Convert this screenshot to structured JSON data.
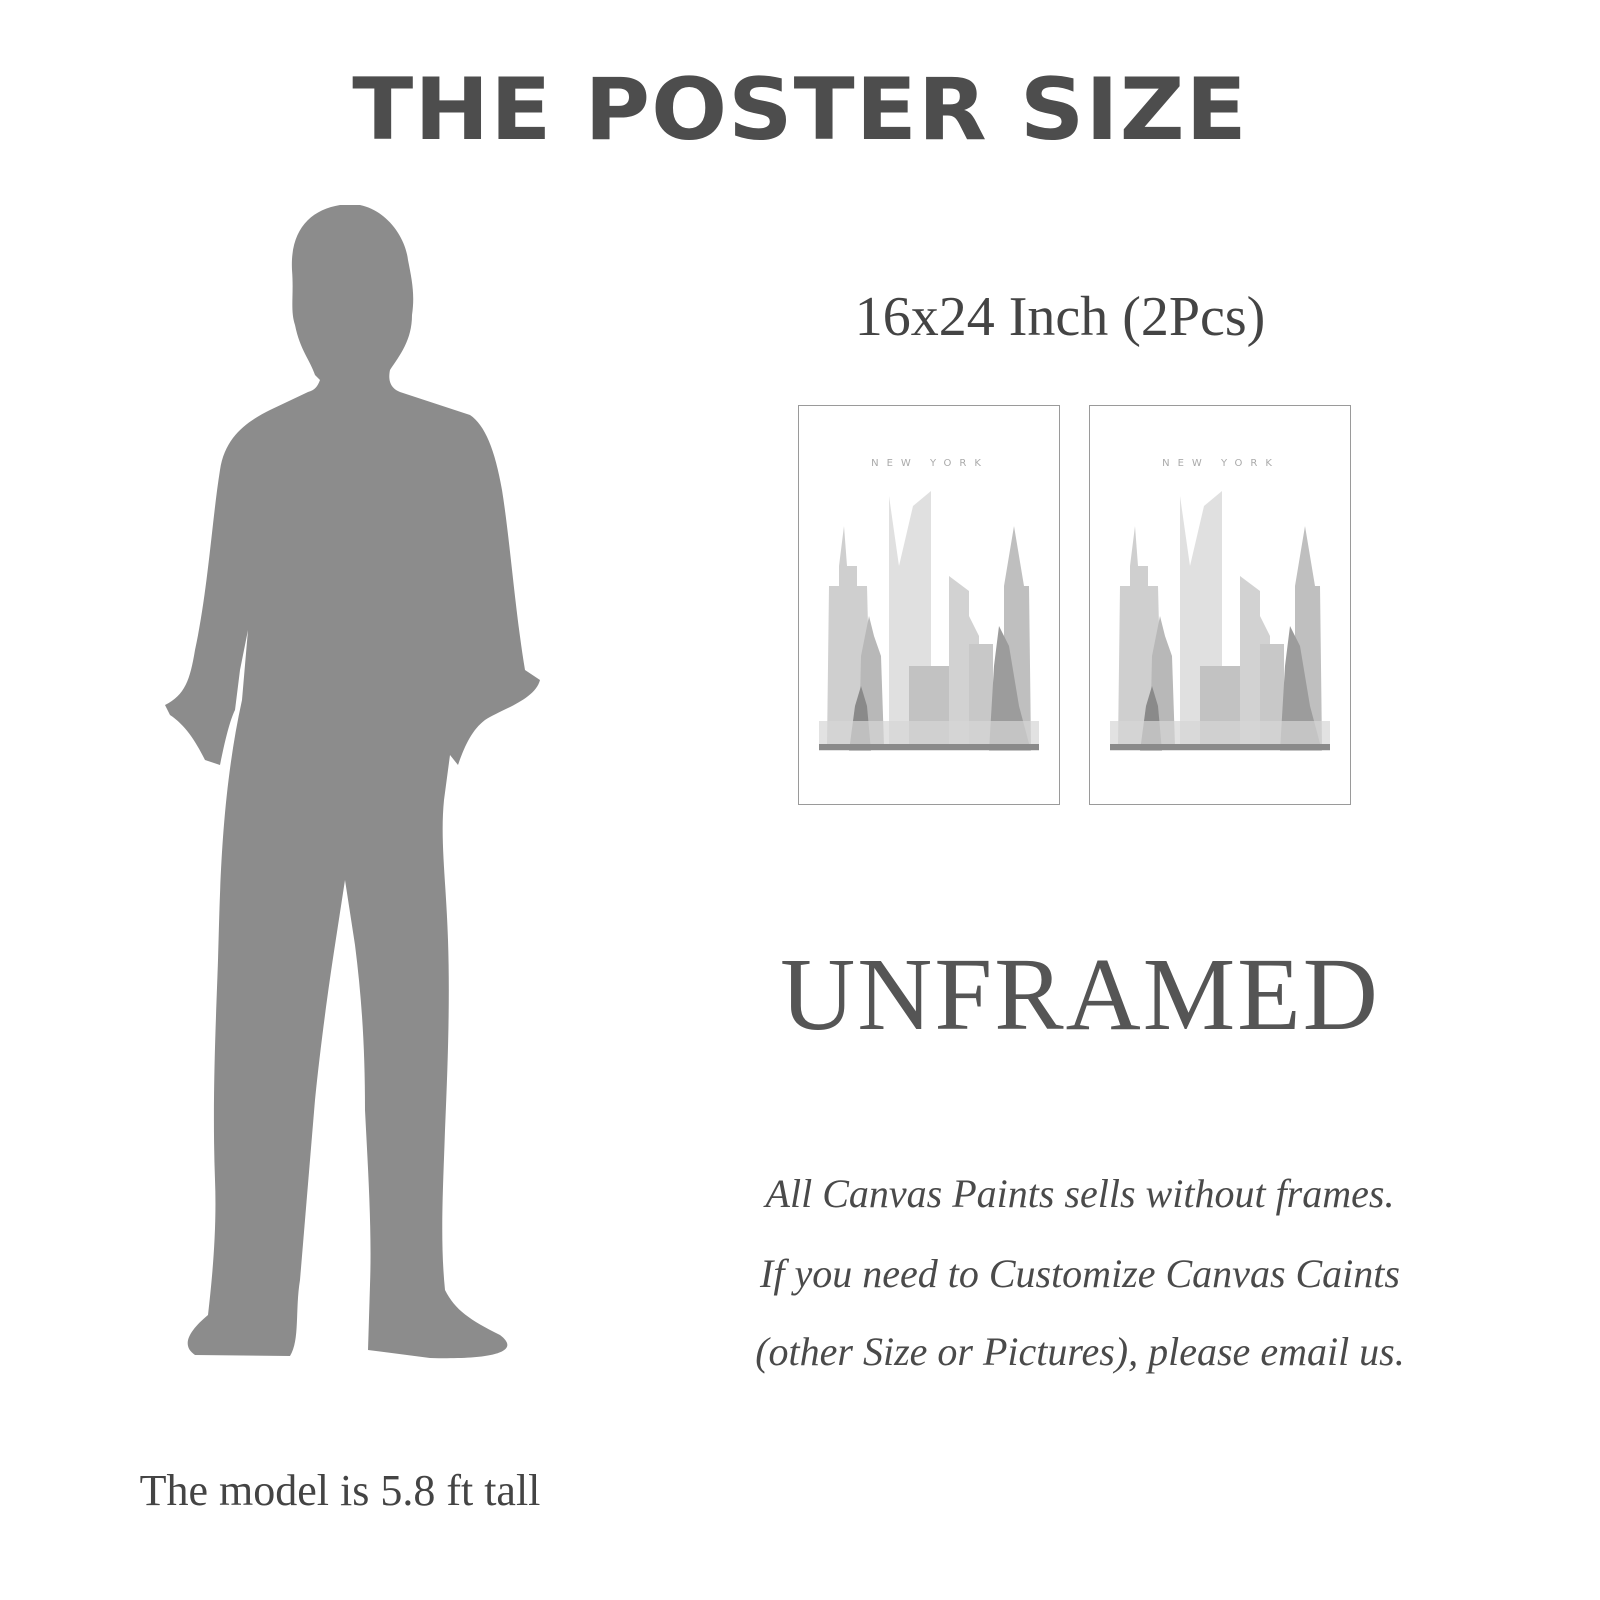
{
  "heading": "THE POSTER SIZE",
  "size_label": "16x24 Inch (2Pcs)",
  "posters": [
    {
      "caption": "NEW YORK"
    },
    {
      "caption": "NEW YORK"
    }
  ],
  "unframed_label": "UNFRAMED",
  "notice_lines": [
    "All Canvas Paints sells without frames.",
    "If you need to Customize Canvas Caints",
    "(other Size or Pictures), please email us."
  ],
  "model_caption": "The model is 5.8 ft tall",
  "colors": {
    "silhouette": "#8c8c8c",
    "heading": "#4d4d4d"
  }
}
